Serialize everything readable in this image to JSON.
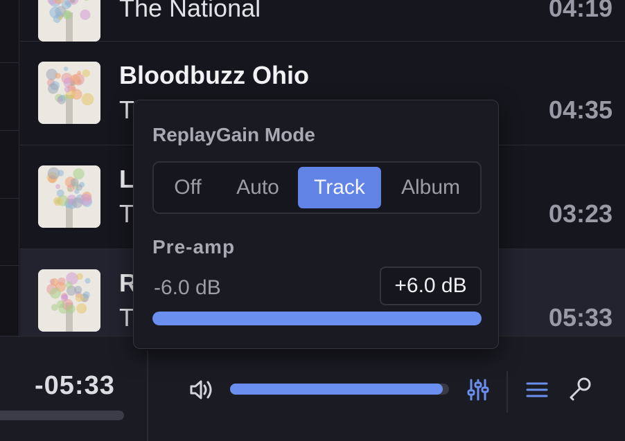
{
  "tracks": [
    {
      "title": "",
      "artist": "The National",
      "duration": "04:19"
    },
    {
      "title": "Bloodbuzz Ohio",
      "artist": "T",
      "duration": "04:35"
    },
    {
      "title": "L",
      "artist": "T",
      "duration": "03:23"
    },
    {
      "title": "R",
      "artist": "T",
      "duration": "05:33"
    }
  ],
  "player": {
    "time_remaining": "-05:33",
    "volume_level": 0.97,
    "icons": {
      "volume": "speaker-volume-icon",
      "equalizer": "equalizer-sliders-icon",
      "queue": "queue-list-icon",
      "settings": "wrench-key-icon"
    }
  },
  "popover": {
    "title": "ReplayGain Mode",
    "modes": [
      {
        "label": "Off",
        "selected": false
      },
      {
        "label": "Auto",
        "selected": false
      },
      {
        "label": "Track",
        "selected": true
      },
      {
        "label": "Album",
        "selected": false
      }
    ],
    "preamp_label": "Pre-amp",
    "preamp_min": "-6.0 dB",
    "preamp_value": "+6.0 dB",
    "preamp_level": 1.0
  },
  "colors": {
    "accent": "#6283e6",
    "background": "#16161e",
    "panel": "#1a1a23"
  }
}
